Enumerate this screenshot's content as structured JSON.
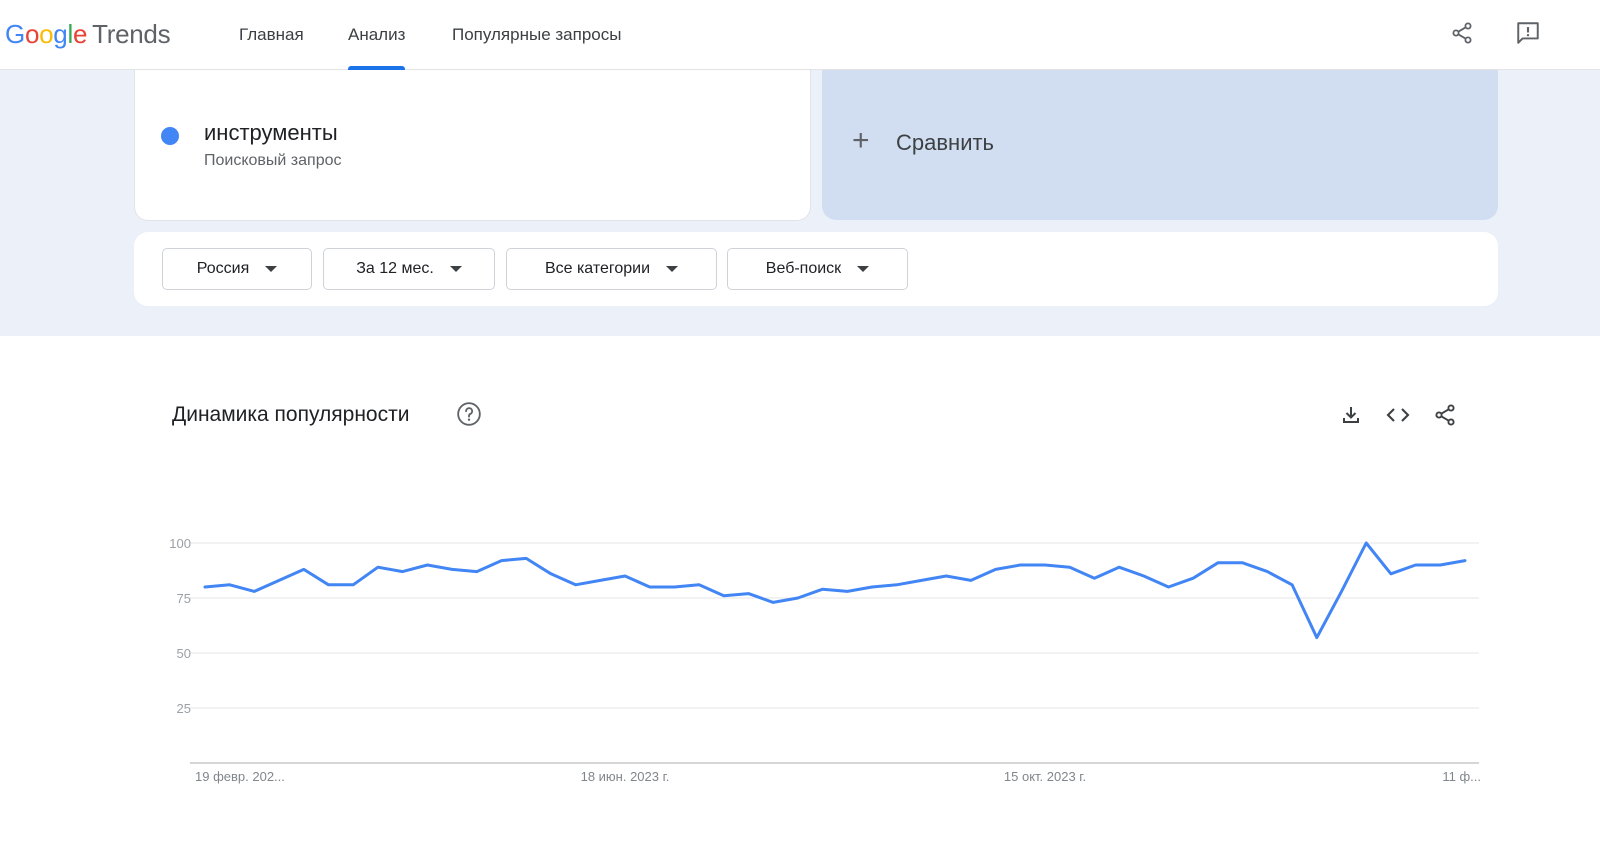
{
  "header": {
    "logo_letters": [
      "G",
      "o",
      "o",
      "g",
      "l",
      "e"
    ],
    "logo_product": "Trends",
    "nav": [
      {
        "label": "Главная",
        "active": false
      },
      {
        "label": "Анализ",
        "active": true
      },
      {
        "label": "Популярные запросы",
        "active": false
      }
    ],
    "icons": [
      "share-icon",
      "feedback-icon"
    ]
  },
  "search_term": {
    "name": "инструменты",
    "type": "Поисковый запрос",
    "color": "#4285f4"
  },
  "compare": {
    "label": "Сравнить"
  },
  "filters": [
    {
      "label": "Россия"
    },
    {
      "label": "За 12 мес."
    },
    {
      "label": "Все категории"
    },
    {
      "label": "Веб-поиск"
    }
  ],
  "interest_over_time": {
    "title": "Динамика популярности",
    "tools": [
      "download-icon",
      "embed-icon",
      "share-icon"
    ]
  },
  "chart_data": {
    "type": "line",
    "ylim": [
      0,
      100
    ],
    "y_ticks": [
      100,
      75,
      50,
      25
    ],
    "grid": true,
    "x_tick_labels": [
      "19 февр. 202...",
      "18 июн. 2023 г.",
      "15 окт. 2023 г.",
      "11 ф..."
    ],
    "x_tick_positions": [
      0,
      17,
      34,
      51
    ],
    "series": [
      {
        "color": "#4285f4",
        "values": [
          80,
          81,
          78,
          83,
          88,
          81,
          81,
          89,
          87,
          90,
          88,
          87,
          92,
          93,
          86,
          81,
          83,
          85,
          80,
          80,
          81,
          76,
          77,
          73,
          75,
          79,
          78,
          80,
          81,
          83,
          85,
          83,
          88,
          90,
          90,
          89,
          84,
          89,
          85,
          80,
          84,
          91,
          91,
          87,
          81,
          57,
          78,
          100,
          86,
          90,
          90,
          92
        ]
      }
    ]
  }
}
